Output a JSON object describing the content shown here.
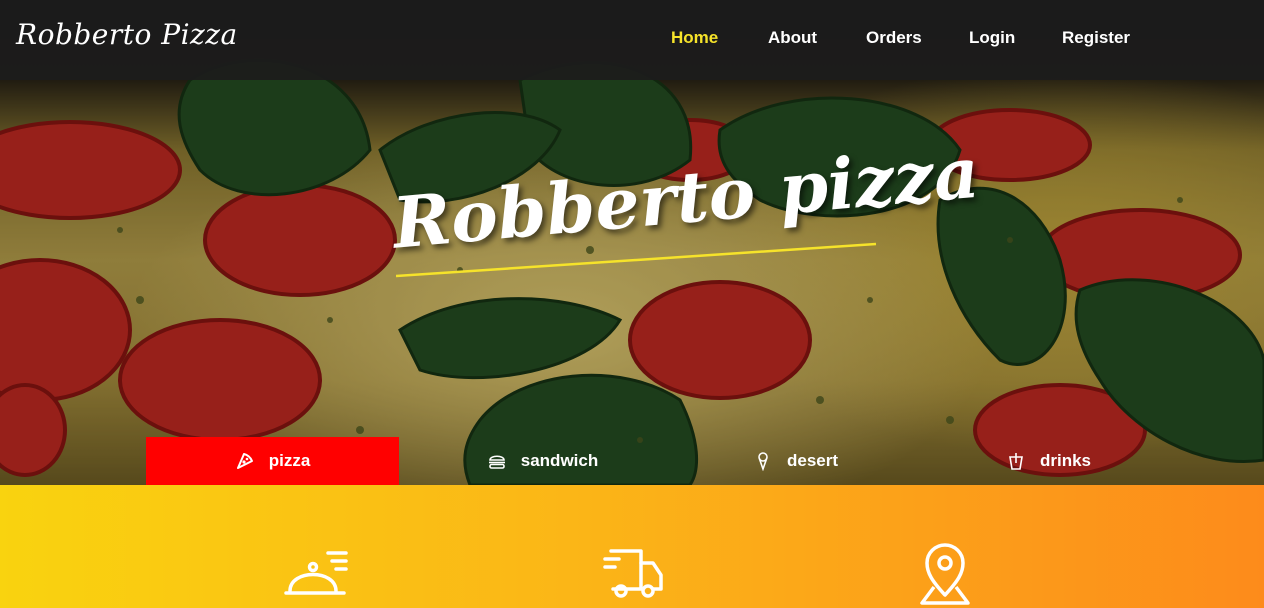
{
  "brand": "Robberto Pizza",
  "nav": [
    {
      "label": "Home",
      "active": true
    },
    {
      "label": "About"
    },
    {
      "label": "Orders"
    },
    {
      "label": "Login"
    },
    {
      "label": "Register"
    }
  ],
  "hero": {
    "title": "Robberto pizza"
  },
  "tabs": [
    {
      "label": "pizza",
      "icon": "pizza-icon",
      "active": true
    },
    {
      "label": "sandwich",
      "icon": "burger-icon"
    },
    {
      "label": "desert",
      "icon": "ice-cream-icon"
    },
    {
      "label": "drinks",
      "icon": "drink-icon"
    }
  ],
  "features": [
    {
      "icon": "serving-dish-icon"
    },
    {
      "icon": "delivery-truck-icon"
    },
    {
      "icon": "location-pin-icon"
    }
  ],
  "colors": {
    "accent_yellow": "#f6e32a",
    "tab_active": "#ff0000",
    "band_start": "#f9d30f",
    "band_end": "#fd8b1b"
  }
}
